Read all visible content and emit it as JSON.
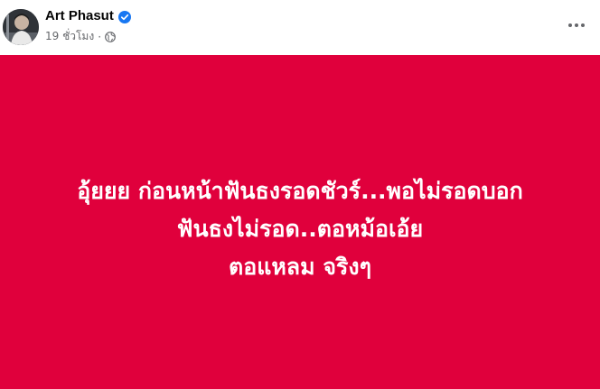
{
  "post": {
    "author": {
      "name": "Art Phasut",
      "verified": true,
      "avatar_icon": "profile-photo"
    },
    "timestamp": "19 ชั่วโมง",
    "separator": "·",
    "audience_icon": "globe-icon",
    "more_icon": "more-horizontal-icon",
    "status": {
      "background_color": "#e0003c",
      "text_color": "#ffffff",
      "lines": [
        "อุ้ยยย ก่อนหน้าฟันธงรอดชัวร์...พอไม่รอดบอก",
        "ฟันธงไม่รอด..ตอหม้อเอ้ย",
        "ตอแหลม จริงๆ"
      ]
    }
  },
  "colors": {
    "verified_badge": "#1877f2",
    "meta_text": "#65676b",
    "name_text": "#050505"
  }
}
